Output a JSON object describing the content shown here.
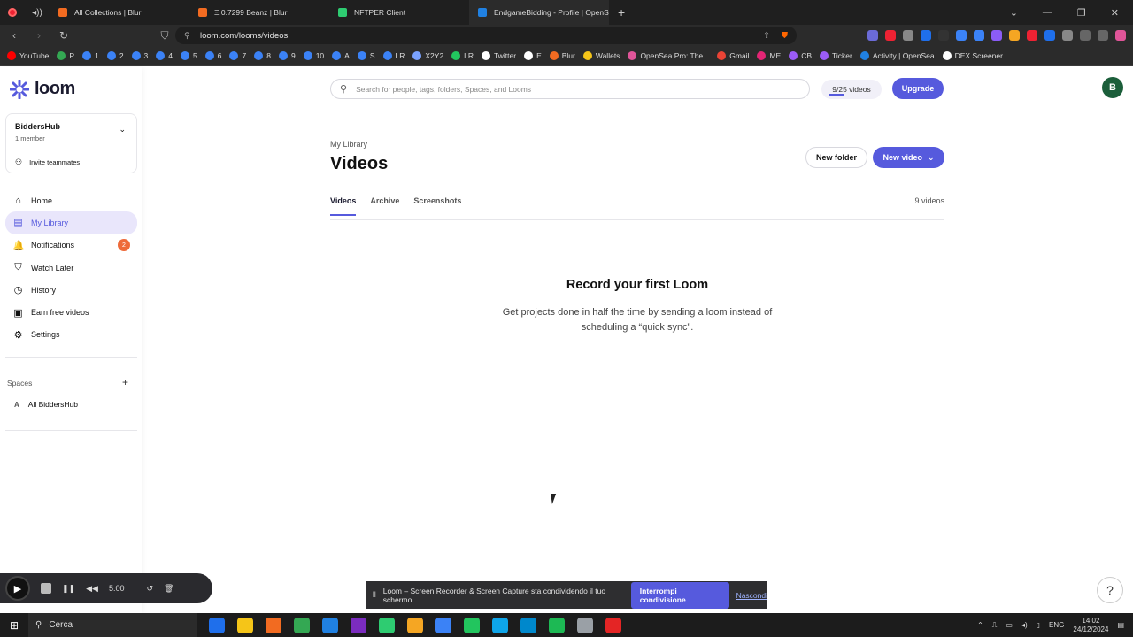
{
  "browser": {
    "tabs": [
      {
        "label": "All Collections | Blur",
        "color": "#f26b21"
      },
      {
        "label": "Ξ 0.7299 Beanz | Blur",
        "color": "#f26b21"
      },
      {
        "label": "NFTPER Client",
        "color": "#2ecc71"
      },
      {
        "label": "EndgameBidding - Profile | OpenSe",
        "color": "#2081e2"
      }
    ],
    "url": "loom.com/looms/videos",
    "bookmarks": [
      {
        "label": "YouTube",
        "color": "#ff0000"
      },
      {
        "label": "P",
        "color": "#34a853"
      },
      {
        "label": "1",
        "color": "#3b82f6"
      },
      {
        "label": "2",
        "color": "#3b82f6"
      },
      {
        "label": "3",
        "color": "#3b82f6"
      },
      {
        "label": "4",
        "color": "#3b82f6"
      },
      {
        "label": "5",
        "color": "#3b82f6"
      },
      {
        "label": "6",
        "color": "#3b82f6"
      },
      {
        "label": "7",
        "color": "#3b82f6"
      },
      {
        "label": "8",
        "color": "#3b82f6"
      },
      {
        "label": "9",
        "color": "#3b82f6"
      },
      {
        "label": "10",
        "color": "#3b82f6"
      },
      {
        "label": "A",
        "color": "#3b82f6"
      },
      {
        "label": "S",
        "color": "#3b82f6"
      },
      {
        "label": "LR",
        "color": "#3b82f6"
      },
      {
        "label": "X2Y2",
        "color": "#7aa2ff"
      },
      {
        "label": "LR",
        "color": "#22c55e"
      },
      {
        "label": "Twitter",
        "color": "#ffffff"
      },
      {
        "label": "E",
        "color": "#ffffff"
      },
      {
        "label": "Blur",
        "color": "#f26b21"
      },
      {
        "label": "Wallets",
        "color": "#f5c518"
      },
      {
        "label": "OpenSea Pro: The...",
        "color": "#e05599"
      },
      {
        "label": "Gmail",
        "color": "#ea4335"
      },
      {
        "label": "ME",
        "color": "#e42575"
      },
      {
        "label": "CB",
        "color": "#9b5cf6"
      },
      {
        "label": "Ticker",
        "color": "#9b5cf6"
      },
      {
        "label": "Activity | OpenSea",
        "color": "#2081e2"
      },
      {
        "label": "DEX Screener",
        "color": "#ffffff"
      }
    ]
  },
  "app": {
    "logo": "loom",
    "workspace": {
      "name": "BiddersHub",
      "members": "1 member",
      "invite": "Invite teammates"
    },
    "nav": [
      {
        "label": "Home",
        "icon": "home-icon",
        "glyph": "⌂"
      },
      {
        "label": "My Library",
        "icon": "library-icon",
        "glyph": "▤"
      },
      {
        "label": "Notifications",
        "icon": "bell-icon",
        "glyph": "🔔",
        "badge": "2"
      },
      {
        "label": "Watch Later",
        "icon": "bookmark-icon",
        "glyph": "⛉"
      },
      {
        "label": "History",
        "icon": "clock-icon",
        "glyph": "◷"
      },
      {
        "label": "Earn free videos",
        "icon": "gift-icon",
        "glyph": "▣"
      },
      {
        "label": "Settings",
        "icon": "gear-icon",
        "glyph": "⚙"
      }
    ],
    "spaces": {
      "label": "Spaces",
      "items": [
        {
          "initial": "A",
          "label": "All BiddersHub"
        }
      ]
    },
    "search": {
      "placeholder": "Search for people, tags, folders, Spaces, and Looms"
    },
    "quota": "9/25 videos",
    "upgrade": "Upgrade",
    "avatar": "B",
    "breadcrumb": "My Library",
    "title": "Videos",
    "new_folder": "New folder",
    "new_video": "New video",
    "tabs": [
      "Videos",
      "Archive",
      "Screenshots"
    ],
    "video_count": "9 videos",
    "empty": {
      "title": "Record your first Loom",
      "desc": "Get projects done in half the time by sending a loom instead of scheduling a “quick sync”."
    },
    "accent": "#565ADD"
  },
  "recorder": {
    "time": "5:00"
  },
  "share_bar": {
    "message": "Loom – Screen Recorder & Screen Capture sta condividendo il tuo schermo.",
    "stop": "Interrompi condivisione",
    "hide": "Nascondi"
  },
  "taskbar": {
    "search": "Cerca",
    "lang": "ENG",
    "time": "14:02",
    "date": "24/12/2024",
    "apps": [
      "#1f6feb",
      "#f5c518",
      "#f26b21",
      "#34a853",
      "#2081e2",
      "#7b2cbf",
      "#2ecc71",
      "#f5a623",
      "#3b82f6",
      "#22c55e",
      "#0ea5e9",
      "#0088cc",
      "#1db954",
      "#9aa0a6",
      "#e42525"
    ]
  }
}
